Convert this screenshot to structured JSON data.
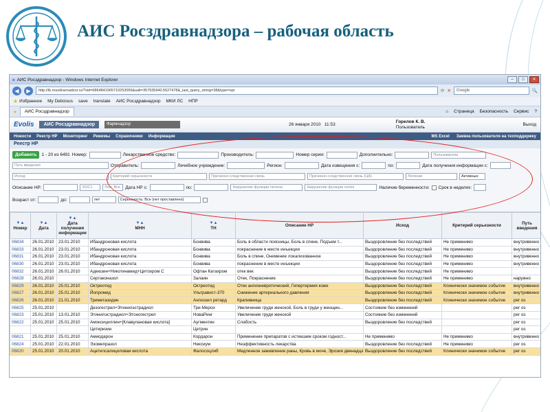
{
  "slide": {
    "title": "АИС Росздравнадзора – рабочая область"
  },
  "browser": {
    "window_title": "АИС Росздравнадзор - Windows Internet Explorer",
    "url": "http://ib.roszdravnadzor.ru/?sid=6864841905710253056&salt=357935940.5527478&_last_query_string=38&type=npr",
    "search_placeholder": "Google",
    "favorites": {
      "label": "Избранное",
      "items": [
        "My Delicious",
        "save",
        "translate",
        "АИС Росздравнадзор",
        "МКИ ЛС",
        "НПР"
      ]
    },
    "tab": "АИС Росздравнадзор",
    "tools": [
      "Страница",
      "Безопасность",
      "Сервис"
    ]
  },
  "app": {
    "logo_text": "Evolis",
    "name": "АИС Росздравнадзор",
    "org": "Фармнадзор",
    "date": "26 января 2010",
    "time": "11:53",
    "user_name": "Горелов К. В.",
    "user_role": "Пользователь",
    "exit": "Выход",
    "menu": [
      "Новости",
      "Реестр НР",
      "Мониторинг",
      "Режимы",
      "Справочники",
      "Информация"
    ],
    "menu_right": [
      "MS Excel",
      "Заявка пользователя на техподдержку"
    ],
    "registry_title": "Реестр НР"
  },
  "filters": {
    "add_button": "Добавить",
    "range": "1 - 20 из 6491",
    "labels": {
      "nomer": "Номер:",
      "lek": "Лекарственное средство:",
      "proizv": "Производитель:",
      "seria": "Номер серии:",
      "dop": "Дополнительно:",
      "otprav": "Отправитель:",
      "lech": "Лечебное учреждение:",
      "region": "Регион:",
      "data_izv": "Дата извещения с:",
      "po": "по:",
      "data_info": "Дата получения информации с:",
      "opisanie": "Описание НР:",
      "data_nr": "Дата НР с:",
      "po2": "по:",
      "berem": "Наличие беременности:",
      "srok": "Срок в неделях:",
      "vozrast": "Возраст от:",
      "do": "до:"
    },
    "placeholders": {
      "users": "Пользователи",
      "put": "Путь введения",
      "ishod": "Исход",
      "kriteriy": "Критерий серьезности",
      "prich1": "Причинно-следственная связь",
      "prich2": "Причинно-следственная связь (ЦА)",
      "lechenie": "Лечение",
      "narush_pech": "Нарушение функции печени",
      "narush_poch": "Нарушение функции почек",
      "soc": "SOC1",
      "pol": "Пол: Все",
      "let": "лет",
      "serious": "Серьезность: Все (нет проставлено)"
    },
    "active": "Активные"
  },
  "table": {
    "columns": [
      "Номер",
      "Дата",
      "Дата получения информации",
      "МНН",
      "ТН",
      "Описание НР",
      "Исход",
      "Критерий серьезности",
      "Путь введения"
    ],
    "rows": [
      {
        "id": "06834",
        "date": "26.01.2010",
        "recv": "23.01.2010",
        "mnn": "Ибандроновая кислота",
        "tn": "Бонвива",
        "desc": "Боль в области поясницы, Боль в спине, Подъем т...",
        "outcome": "Выздоровление без последствий",
        "crit": "Не применимо",
        "route": "внутривенно",
        "hl": false
      },
      {
        "id": "06833",
        "date": "26.01.2010",
        "recv": "23.01.2010",
        "mnn": "Ибандроновая кислота",
        "tn": "Бонвива",
        "desc": "покраснение в месте инъекции",
        "outcome": "Выздоровление без последствий",
        "crit": "Не применимо",
        "route": "внутривенно",
        "hl": false
      },
      {
        "id": "06831",
        "date": "26.01.2010",
        "recv": "23.01.2010",
        "mnn": "Ибандроновая кислота",
        "tn": "Бонвива",
        "desc": "Боль в спине, Онемение локализованное",
        "outcome": "Выздоровление без последствий",
        "crit": "Не применимо",
        "route": "внутривенно",
        "hl": false
      },
      {
        "id": "06830",
        "date": "26.01.2010",
        "recv": "23.01.2010",
        "mnn": "Ибандроновая кислота",
        "tn": "Бонвива",
        "desc": "покраснение в месте инъекции",
        "outcome": "Выздоровление без последствий",
        "crit": "Не применимо",
        "route": "внутривенно",
        "hl": false
      },
      {
        "id": "06832",
        "date": "26.01.2010",
        "recv": "26.01.2010",
        "mnn": "Адеюзин+Никотинамид+Цитохром С",
        "tn": "Офтан Катахром",
        "desc": "отек век",
        "outcome": "Выздоровление без последствий",
        "crit": "Не применимо",
        "route": "",
        "hl": false
      },
      {
        "id": "06828",
        "date": "26.01.2010",
        "recv": "",
        "mnn": "Сертаконазол",
        "tn": "Залаин",
        "desc": "Отек, Покраснение",
        "outcome": "Выздоровление без последствий",
        "crit": "Не применимо",
        "route": "наружно",
        "hl": false
      },
      {
        "id": "06829",
        "date": "26.01.2010",
        "recv": "25.01.2010",
        "mnn": "Октреотид",
        "tn": "Октреотид",
        "desc": "Отек ангионевротический, Гипертермия кожи",
        "outcome": "Выздоровление без последствий",
        "crit": "Клинически значимое событие",
        "route": "внутривенно",
        "hl": true
      },
      {
        "id": "06827",
        "date": "26.01.2010",
        "recv": "25.01.2010",
        "mnn": "Йопромид",
        "tn": "Ультравист-370",
        "desc": "Снижение артериального давления",
        "outcome": "Выздоровление без последствий",
        "crit": "Клинически значимое событие",
        "route": "внутривенно",
        "hl": true
      },
      {
        "id": "06826",
        "date": "26.01.2010",
        "recv": "21.01.2010",
        "mnn": "Триметазидин",
        "tn": "Ангиозил ретард",
        "desc": "Крапивница",
        "outcome": "Выздоровление без последствий",
        "crit": "Клинически значимое событие",
        "route": "per os",
        "hl": true
      },
      {
        "id": "06825",
        "date": "25.01.2010",
        "recv": "",
        "mnn": "Дезогестрел+Этинилэстрадиол",
        "tn": "Три-Мерси",
        "desc": "Увеличение груди женской, Боль в груди у женщин...",
        "outcome": "Состояние без изменений",
        "crit": "",
        "route": "per os",
        "hl": false
      },
      {
        "id": "06823",
        "date": "25.01.2010",
        "recv": "13.01.2010",
        "mnn": "Этинилэстрадиол+Этоногестрел",
        "tn": "НоваРинг",
        "desc": "Увеличение груди женской",
        "outcome": "Состояние без изменений",
        "crit": "",
        "route": "per os",
        "hl": false
      },
      {
        "id": "06822",
        "date": "25.01.2010",
        "recv": "25.01.2010",
        "mnn": "Амоксициллин+[Клавулановая кислота]",
        "tn": "Аугментин",
        "desc": "Слабость",
        "outcome": "Выздоровление без последствий",
        "crit": "",
        "route": "per os",
        "hl": false
      },
      {
        "id": "",
        "date": "",
        "recv": "",
        "mnn": "Цетиризин",
        "tn": "Цетрин",
        "desc": "",
        "outcome": "",
        "crit": "",
        "route": "per os",
        "hl": false
      },
      {
        "id": "06821",
        "date": "25.01.2010",
        "recv": "25.01.2010",
        "mnn": "Амиодарон",
        "tn": "Кордарон",
        "desc": "Применение препаратов с истекшим сроком годност...",
        "outcome": "Не применимо",
        "crit": "Не применимо",
        "route": "внутривенно",
        "hl": false
      },
      {
        "id": "06824",
        "date": "25.01.2010",
        "recv": "22.01.2010",
        "mnn": "Эзомепразол",
        "tn": "Нексиум",
        "desc": "Неэффективность лекарства",
        "outcome": "Выздоровление без последствий",
        "crit": "Не применимо",
        "route": "per os",
        "hl": false
      },
      {
        "id": "06820",
        "date": "25.01.2010",
        "recv": "20.01.2010",
        "mnn": "Ацетилсалициловая кислота",
        "tn": "Фалосоцлиб",
        "desc": "Медленное заживление раны, Кровь в моче, Эрозия двенадцати...",
        "outcome": "Выздоровление без последствий",
        "crit": "Клинически значимое событие",
        "route": "per os",
        "hl": true
      }
    ]
  }
}
